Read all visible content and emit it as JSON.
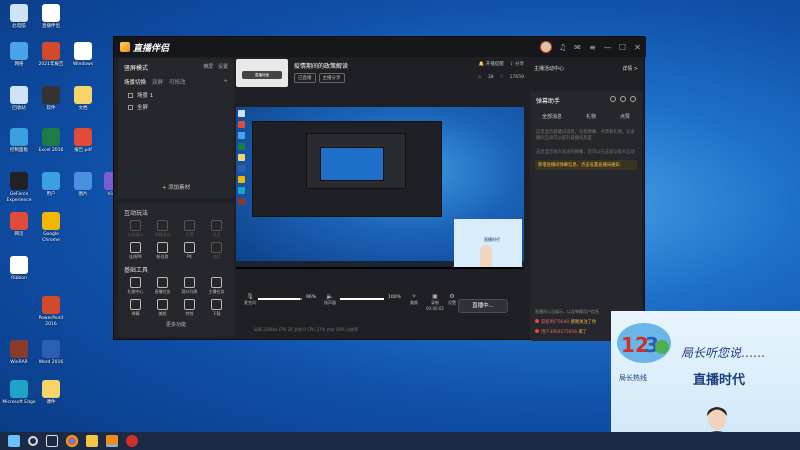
{
  "desktop": {
    "icons": [
      {
        "label": "此电脑",
        "color": "#cfe3f6"
      },
      {
        "label": "直播伴侣",
        "color": "#ffffff"
      },
      {
        "label": "网络",
        "color": "#4aa3e8"
      },
      {
        "label": "2021年报告",
        "color": "#d04a2b"
      },
      {
        "label": "Windows",
        "color": "#ffffff"
      },
      {
        "label": "回收站",
        "color": "#cfe3f6"
      },
      {
        "label": "软件",
        "color": "#333333"
      },
      {
        "label": "文档",
        "color": "#f5d46a"
      },
      {
        "label": "控制面板",
        "color": "#3aa0e0"
      },
      {
        "label": "Excel 2016",
        "color": "#1e7b43"
      },
      {
        "label": "报告.pdf",
        "color": "#e24a3a"
      },
      {
        "label": "GeForce Experience",
        "color": "#222222"
      },
      {
        "label": "用户",
        "color": "#3aa0e0"
      },
      {
        "label": "图片",
        "color": "#4a90e2"
      },
      {
        "label": "网页",
        "color": "#e24a3a"
      },
      {
        "label": "Google Chrome",
        "color": "#f2b705"
      },
      {
        "label": "Vivid",
        "color": "#7b5cd6"
      },
      {
        "label": "Ribbon",
        "color": "#ffffff"
      },
      {
        "label": "PowerPoint 2016",
        "color": "#d04a2b"
      },
      {
        "label": "WinRAR",
        "color": "#8a3b2b"
      },
      {
        "label": "Word 2016",
        "color": "#2b5fb4"
      },
      {
        "label": "Microsoft Edge",
        "color": "#1fa3c7"
      },
      {
        "label": "课件",
        "color": "#f5d46a"
      }
    ]
  },
  "app": {
    "name": "直播伴侣",
    "window_controls": {
      "minimize": "—",
      "maximize": "☐",
      "close": "✕"
    },
    "scene": {
      "mode_label": "竖屏模式",
      "mode_right": [
        "横屏",
        "设置"
      ],
      "tabs": [
        "场景切换",
        "双屏",
        "可修改"
      ],
      "items": [
        "场景 1",
        "全屏"
      ],
      "add_material": "+ 添加素材"
    },
    "interactive": {
      "title": "互动玩法",
      "items": [
        "礼物展示",
        "弹幕滚动",
        "点赞",
        "关注",
        "连线PK",
        "粉丝群",
        "PK",
        "抽奖"
      ]
    },
    "basic_tools": {
      "title": "基础工具",
      "items": [
        "礼物中心",
        "直播任务",
        "观众列表",
        "主播任务",
        "弹幕",
        "美颜",
        "特效",
        "下载"
      ],
      "more": "更多功能"
    },
    "room": {
      "thumb_text": "直播封面",
      "title": "疫情期间的政策解读",
      "badges": [
        "已直播",
        "主播分享"
      ],
      "actions": [
        "开播提醒",
        "分享"
      ],
      "stats": [
        "38",
        "17659"
      ]
    },
    "controls": {
      "mic_label": "麦克风",
      "mic_pct": "96%",
      "mic_level": 0.96,
      "speaker_label": "扬声器",
      "speaker_pct": "100%",
      "speaker_level": 1.0,
      "cam_label": "美颜",
      "record_label": "录制",
      "time": "00:00:02",
      "settings_label": "设置",
      "live_button": "直播中..."
    },
    "status_line": "码率 256kbs   FPS 25   丢帧 0   CPU 37%   内存 50%   分辨率",
    "right": {
      "top_link": "主播活动中心",
      "top_right": "详情 >",
      "panel_title": "弹幕助手",
      "tabs": [
        "全部消息",
        "礼物",
        "点赞"
      ],
      "desc1": "这里显示直播间消息，包括弹幕、点赞和礼物，在直播间互动可以提升直播间热度",
      "desc2": "这里显示观众发送的弹幕，您可以在这里与观众互动",
      "tip": "新增直播间弹幕信息，点击设置直播间通知",
      "footer": "直播间公告展示，以及弹幕用户信息",
      "messages": [
        {
          "user": "游客用户5640",
          "text": "感谢关注了你"
        },
        {
          "user": "用户3950175656",
          "text": "来了"
        }
      ]
    }
  },
  "webcam": {
    "title": "局长听您说……",
    "brand": "直播时代",
    "small": "局长热线"
  },
  "taskbar": {
    "icons": [
      "windows-start",
      "search",
      "task-view",
      "chrome",
      "explorer",
      "live-app",
      "red-app"
    ]
  }
}
